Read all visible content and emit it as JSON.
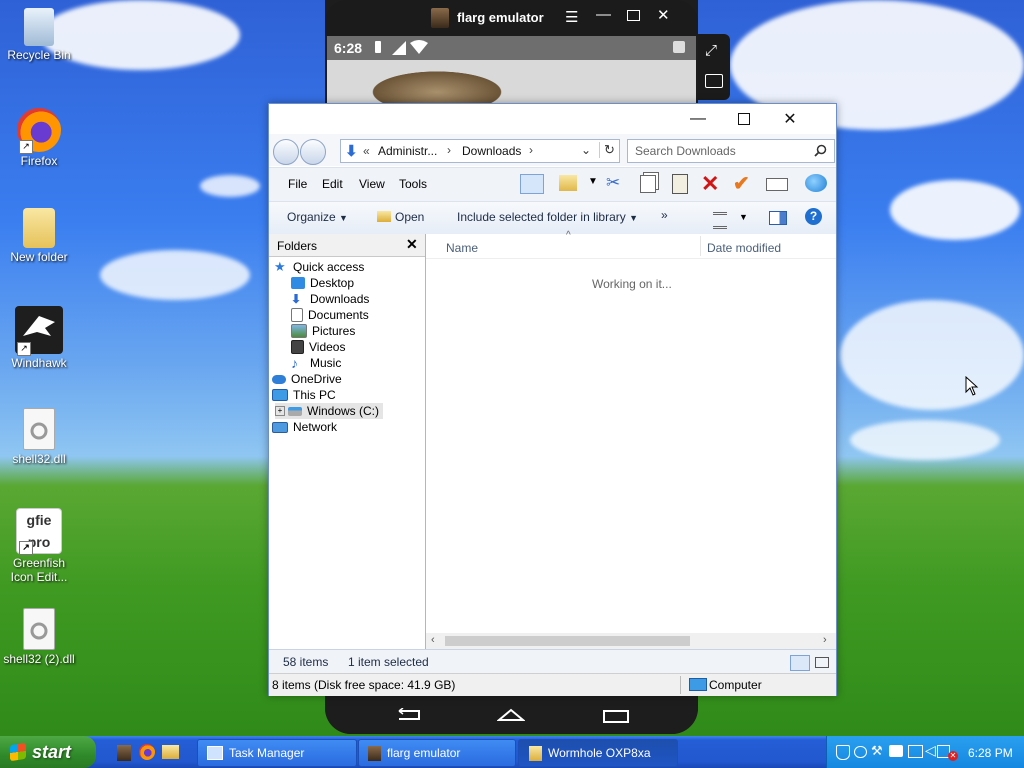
{
  "desktop": {
    "icons": [
      {
        "label": "Recycle Bin"
      },
      {
        "label": "Firefox"
      },
      {
        "label": "New folder"
      },
      {
        "label": "Windhawk"
      },
      {
        "label": "shell32.dll"
      },
      {
        "label": "Greenfish Icon Edit..."
      },
      {
        "label": "shell32 (2).dll"
      }
    ]
  },
  "emulator": {
    "title": "flarg emulator",
    "time": "6:28"
  },
  "explorer": {
    "address": {
      "prefix": "«",
      "crumb1": "Administr...",
      "crumb2": "Downloads"
    },
    "search_placeholder": "Search Downloads",
    "menu": [
      "File",
      "Edit",
      "View",
      "Tools"
    ],
    "commands": {
      "organize": "Organize",
      "open": "Open",
      "include": "Include selected folder in library",
      "more": "»"
    },
    "folders_title": "Folders",
    "tree": [
      "Quick access",
      "Desktop",
      "Downloads",
      "Documents",
      "Pictures",
      "Videos",
      "Music",
      "OneDrive",
      "This PC",
      "Windows (C:)",
      "Network"
    ],
    "columns": {
      "name": "Name",
      "date": "Date modified"
    },
    "working": "Working on it...",
    "status": {
      "items": "58 items",
      "selected": "1 item selected"
    },
    "details": {
      "text": "8 items (Disk free space: 41.9 GB)",
      "location": "Computer"
    }
  },
  "taskbar": {
    "start": "start",
    "tasks": [
      "Task Manager",
      "flarg emulator",
      "Wormhole OXP8xa"
    ],
    "clock": "6:28 PM"
  }
}
